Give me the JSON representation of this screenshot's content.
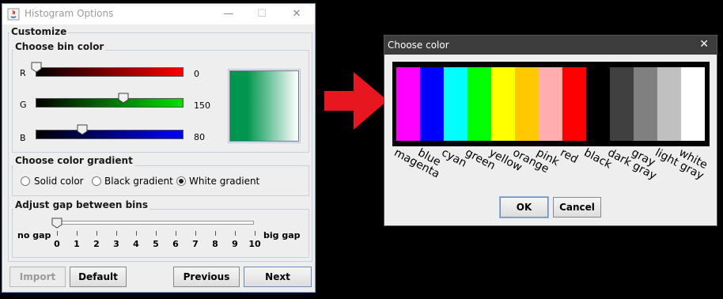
{
  "histogram_window": {
    "title": "Histogram Options",
    "controls": {
      "minimize": "—",
      "maximize": "☐",
      "close": "✕"
    },
    "customize_legend": "Customize",
    "bin_color": {
      "legend": "Choose bin color",
      "channels": [
        {
          "label": "R",
          "value": "0",
          "fraction": 0.0,
          "color": "#ff0000"
        },
        {
          "label": "G",
          "value": "150",
          "fraction": 0.59,
          "color": "#00dd00"
        },
        {
          "label": "B",
          "value": "80",
          "fraction": 0.31,
          "color": "#0000ff"
        }
      ],
      "preview_color": "#009650"
    },
    "gradient": {
      "legend": "Choose color gradient",
      "options": [
        {
          "label": "Solid color",
          "selected": false
        },
        {
          "label": "Black gradient",
          "selected": false
        },
        {
          "label": "White gradient",
          "selected": true
        }
      ]
    },
    "gap": {
      "legend": "Adjust gap between bins",
      "min_label": "no gap",
      "max_label": "big gap",
      "value": 0,
      "ticks": [
        "0",
        "1",
        "2",
        "3",
        "4",
        "5",
        "6",
        "7",
        "8",
        "9",
        "10"
      ]
    },
    "buttons": {
      "import": "Import",
      "default": "Default",
      "previous": "Previous",
      "next": "Next"
    }
  },
  "choose_color_dialog": {
    "title": "Choose color",
    "close": "✕",
    "colors": [
      {
        "name": "magenta",
        "hex": "#ff00ff"
      },
      {
        "name": "blue",
        "hex": "#0000ff"
      },
      {
        "name": "cyan",
        "hex": "#00ffff"
      },
      {
        "name": "green",
        "hex": "#00ff00"
      },
      {
        "name": "yellow",
        "hex": "#ffff00"
      },
      {
        "name": "orange",
        "hex": "#ffc800"
      },
      {
        "name": "pink",
        "hex": "#ffafaf"
      },
      {
        "name": "red",
        "hex": "#ff0000"
      },
      {
        "name": "black",
        "hex": "#000000"
      },
      {
        "name": "dark gray",
        "hex": "#404040"
      },
      {
        "name": "gray",
        "hex": "#808080"
      },
      {
        "name": "light gray",
        "hex": "#c0c0c0"
      },
      {
        "name": "white",
        "hex": "#ffffff"
      }
    ],
    "ok_label": "OK",
    "cancel_label": "Cancel"
  },
  "arrow_color": "#e8161e"
}
